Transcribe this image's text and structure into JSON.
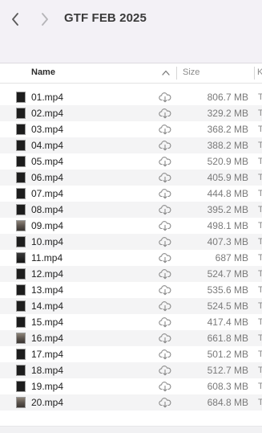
{
  "toolbar": {
    "title": "GTF FEB 2025"
  },
  "columns": {
    "name": "Name",
    "size": "Size",
    "kind_fragment": "K"
  },
  "icons": {
    "back": "chevron-left-icon",
    "forward": "chevron-right-icon",
    "sort": "chevron-up-icon",
    "cloud": "cloud-download-icon",
    "thumbnail": "video-thumbnail-icon"
  },
  "files": [
    {
      "name": "01.mp4",
      "size": "806.7 MB"
    },
    {
      "name": "02.mp4",
      "size": "329.2 MB"
    },
    {
      "name": "03.mp4",
      "size": "368.2 MB"
    },
    {
      "name": "04.mp4",
      "size": "388.2 MB"
    },
    {
      "name": "05.mp4",
      "size": "520.9 MB"
    },
    {
      "name": "06.mp4",
      "size": "405.9 MB"
    },
    {
      "name": "07.mp4",
      "size": "444.8 MB"
    },
    {
      "name": "08.mp4",
      "size": "395.2 MB"
    },
    {
      "name": "09.mp4",
      "size": "498.1 MB"
    },
    {
      "name": "10.mp4",
      "size": "407.3 MB"
    },
    {
      "name": "11.mp4",
      "size": "687 MB"
    },
    {
      "name": "12.mp4",
      "size": "524.7 MB"
    },
    {
      "name": "13.mp4",
      "size": "535.6 MB"
    },
    {
      "name": "14.mp4",
      "size": "524.5 MB"
    },
    {
      "name": "15.mp4",
      "size": "417.4 MB"
    },
    {
      "name": "16.mp4",
      "size": "661.8 MB"
    },
    {
      "name": "17.mp4",
      "size": "501.2 MB"
    },
    {
      "name": "18.mp4",
      "size": "512.7 MB"
    },
    {
      "name": "19.mp4",
      "size": "608.3 MB"
    },
    {
      "name": "20.mp4",
      "size": "684.8 MB"
    }
  ]
}
